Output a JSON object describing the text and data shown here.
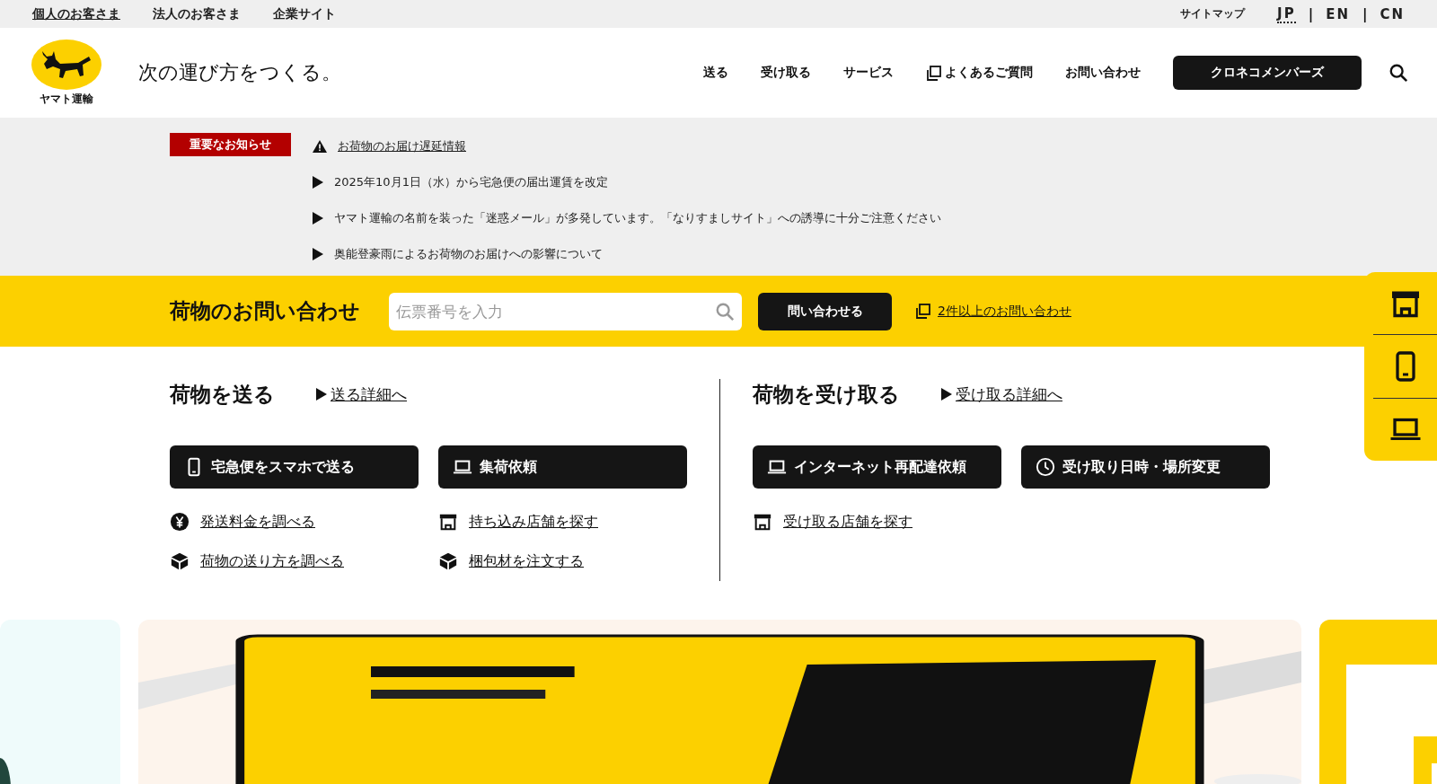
{
  "top_bar": {
    "segments": [
      {
        "label": "個人のお客さま",
        "selected": true
      },
      {
        "label": "法人のお客さま",
        "selected": false
      },
      {
        "label": "企業サイト",
        "selected": false
      }
    ],
    "sitemap": "サイトマップ",
    "languages": [
      {
        "kind": "language",
        "label": "JP",
        "selected": true
      },
      {
        "kind": "separator",
        "label": "|"
      },
      {
        "kind": "language",
        "label": "EN",
        "selected": false
      },
      {
        "kind": "separator",
        "label": "|"
      },
      {
        "kind": "language",
        "label": "CN",
        "selected": false
      }
    ]
  },
  "header": {
    "logo_text": "ヤマト運輸",
    "tagline": "次の運び方をつくる。",
    "nav": [
      {
        "kind": "link",
        "label": "送る"
      },
      {
        "kind": "link",
        "label": "受け取る"
      },
      {
        "kind": "link",
        "label": "サービス"
      },
      {
        "kind": "external",
        "label": "よくあるご質問"
      },
      {
        "kind": "link",
        "label": "お問い合わせ"
      }
    ],
    "member_button": "クロネコメンバーズ"
  },
  "notices": {
    "badge": "重要なお知らせ",
    "items": [
      {
        "kind": "alert",
        "text": "お荷物のお届け遅延情報"
      },
      {
        "kind": "arrow",
        "text": "2025年10月1日（水）から宅急便の届出運賃を改定"
      },
      {
        "kind": "arrow",
        "text": "ヤマト運輸の名前を装った「迷惑メール」が多発しています。「なりすましサイト」への誘導に十分ご注意ください"
      },
      {
        "kind": "arrow",
        "text": "奥能登豪雨によるお荷物のお届けへの影響について"
      }
    ]
  },
  "tracking": {
    "title": "荷物のお問い合わせ",
    "placeholder": "伝票番号を入力",
    "button": "問い合わせる",
    "multi_link": "2件以上のお問い合わせ"
  },
  "sections": [
    {
      "title": "荷物を送る",
      "detail_link": "送る詳細へ",
      "buttons": [
        {
          "kind": "phone",
          "label": "宅急便をスマホで送る"
        },
        {
          "kind": "laptop",
          "label": "集荷依頼"
        }
      ],
      "links": [
        {
          "kind": "yen",
          "label": "発送料金を調べる"
        },
        {
          "kind": "store",
          "label": "持ち込み店舗を探す"
        },
        {
          "kind": "box",
          "label": "荷物の送り方を調べる"
        },
        {
          "kind": "box",
          "label": "梱包材を注文する"
        }
      ]
    },
    {
      "title": "荷物を受け取る",
      "detail_link": "受け取る詳細へ",
      "buttons": [
        {
          "kind": "laptop",
          "label": "インターネット再配達依頼"
        },
        {
          "kind": "clock",
          "label": "受け取り日時・場所変更"
        }
      ],
      "links": [
        {
          "kind": "store",
          "label": "受け取る店舗を探す"
        }
      ]
    }
  ],
  "side_menu": [
    {
      "kind": "store"
    },
    {
      "kind": "phone"
    },
    {
      "kind": "laptop"
    }
  ]
}
